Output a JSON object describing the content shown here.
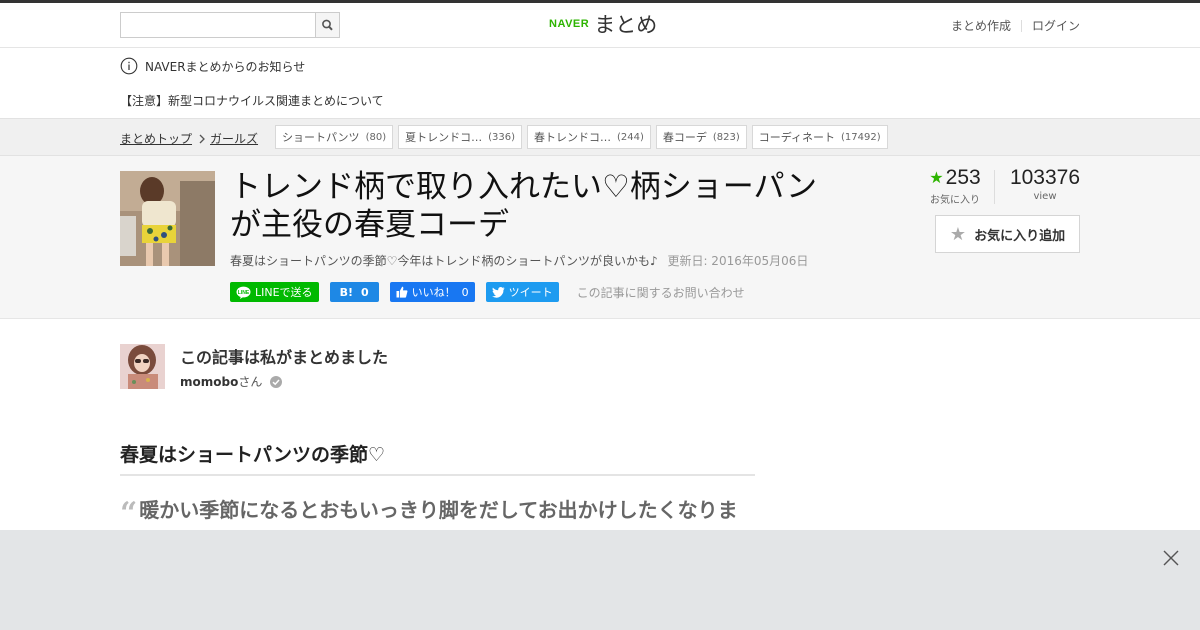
{
  "header": {
    "search_placeholder": "",
    "logo_naver": "NAVER",
    "logo_matome": "まとめ",
    "link_create": "まとめ作成",
    "link_login": "ログイン"
  },
  "notices": {
    "title": "NAVERまとめからのお知らせ",
    "item": "【注意】新型コロナウイルス関連まとめについて"
  },
  "breadcrumb": {
    "top": "まとめトップ",
    "category": "ガールズ"
  },
  "tags": [
    {
      "label": "ショートパンツ",
      "count": "(80)"
    },
    {
      "label": "夏トレンドコ…",
      "count": "(336)"
    },
    {
      "label": "春トレンドコ…",
      "count": "(244)"
    },
    {
      "label": "春コーデ",
      "count": "(823)"
    },
    {
      "label": "コーディネート",
      "count": "(17492)"
    }
  ],
  "article": {
    "title": "トレンド柄で取り入れたい♡柄ショーパンが主役の春夏コーデ",
    "description": "春夏はショートパンツの季節♡今年はトレンド柄のショートパンツが良いかも♪",
    "updated": "更新日: 2016年05月06日",
    "contact": "この記事に関するお問い合わせ"
  },
  "social": {
    "line": "LINEで送る",
    "hatena_icon": "B!",
    "hatena_count": "0",
    "fb_label": "いいね！",
    "fb_count": "0",
    "tweet": "ツイート"
  },
  "stats": {
    "favorites": "253",
    "favorites_label": "お気に入り",
    "views": "103376",
    "views_label": "view",
    "fav_button": "お気に入り追加"
  },
  "author": {
    "heading": "この記事は私がまとめました",
    "name": "momobo",
    "suffix": "さん"
  },
  "section": {
    "heading": "春夏はショートパンツの季節♡",
    "quote": "暖かい季節になるとおもいっきり脚をだしてお出かけしたくなりますよね。ショートパンツはリゾート以外でも大活躍するおしゃれアイテム"
  },
  "colors": {
    "accent": "#2db400",
    "line": "#00b900",
    "hatena": "#1e88e5",
    "facebook": "#1877f2",
    "twitter": "#1d9bf0"
  },
  "icons": [
    "search-icon",
    "info-icon",
    "chevron-right-icon",
    "star-icon",
    "line-icon",
    "facebook-like-icon",
    "twitter-bird-icon",
    "verified-check-icon",
    "close-icon"
  ]
}
